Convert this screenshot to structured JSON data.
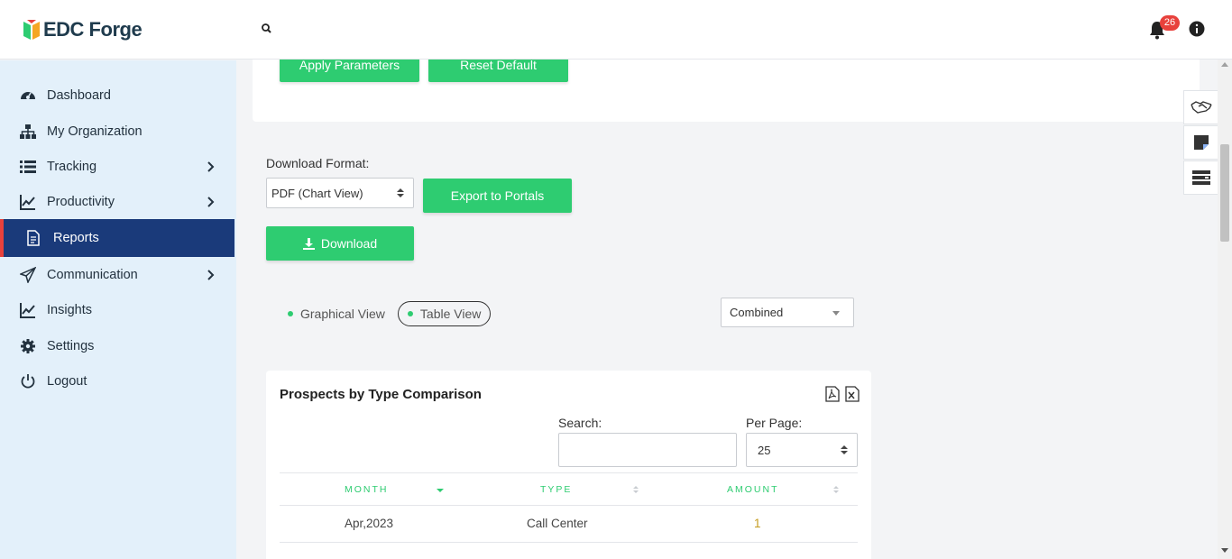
{
  "header": {
    "brand": "EDC Forge",
    "notification_count": "26"
  },
  "sidebar": {
    "items": [
      {
        "label": "Dashboard",
        "icon": "dashboard-gauge-icon",
        "has_submenu": false
      },
      {
        "label": "My Organization",
        "icon": "org-chart-icon",
        "has_submenu": false
      },
      {
        "label": "Tracking",
        "icon": "list-icon",
        "has_submenu": true
      },
      {
        "label": "Productivity",
        "icon": "line-chart-icon",
        "has_submenu": true
      },
      {
        "label": "Reports",
        "icon": "document-icon",
        "has_submenu": false,
        "active": true
      },
      {
        "label": "Communication",
        "icon": "paper-plane-icon",
        "has_submenu": true
      },
      {
        "label": "Insights",
        "icon": "trend-chart-icon",
        "has_submenu": false
      },
      {
        "label": "Settings",
        "icon": "gear-icon",
        "has_submenu": false
      },
      {
        "label": "Logout",
        "icon": "power-icon",
        "has_submenu": false
      }
    ]
  },
  "parameters": {
    "apply_label": "Apply Parameters",
    "reset_label": "Reset Default"
  },
  "download": {
    "format_label": "Download Format:",
    "format_value": "PDF (Chart View)",
    "export_label": "Export to Portals",
    "download_label": "Download"
  },
  "views": {
    "graphical_label": "Graphical View",
    "table_label": "Table View",
    "selected": "Table View",
    "mode_value": "Combined"
  },
  "table": {
    "title": "Prospects by Type Comparison",
    "search_label": "Search:",
    "search_value": "",
    "per_page_label": "Per Page:",
    "per_page_value": "25",
    "columns": [
      "MONTH",
      "TYPE",
      "AMOUNT"
    ],
    "rows": [
      {
        "month": "Apr,2023",
        "type": "Call Center",
        "amount": "1"
      }
    ]
  },
  "colors": {
    "accent_green": "#2ecc71",
    "sidebar_bg": "#e3f0fa",
    "active_nav": "#1a3a7a",
    "active_marker": "#e8413c",
    "badge": "#e8413c"
  }
}
